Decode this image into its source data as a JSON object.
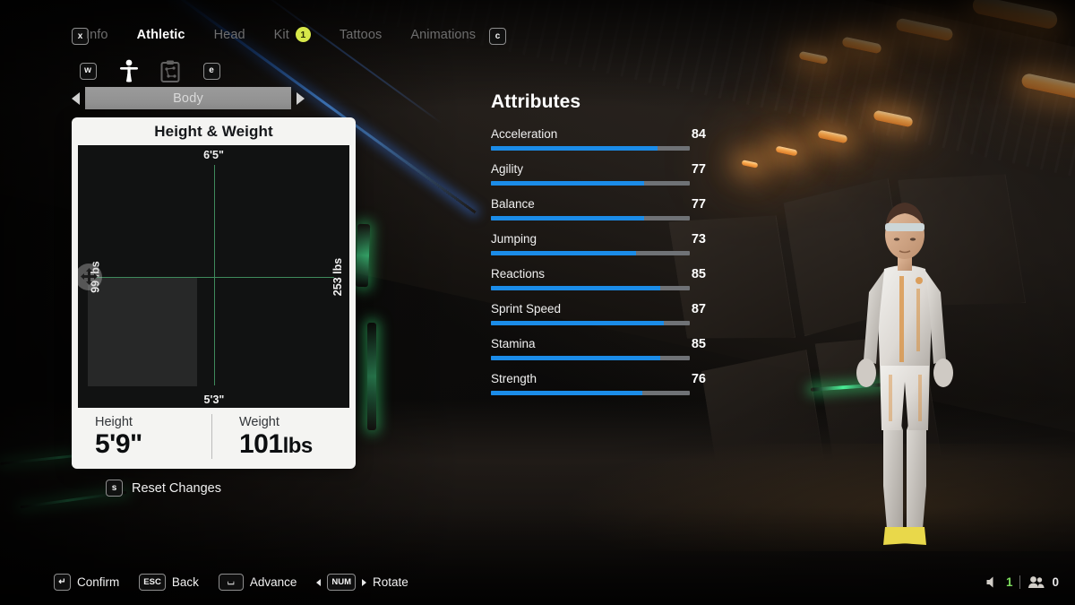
{
  "topbar": {
    "left_key": "x",
    "right_key": "c",
    "tabs": [
      {
        "label": "Info",
        "active": false,
        "badge": null
      },
      {
        "label": "Athletic",
        "active": true,
        "badge": null
      },
      {
        "label": "Head",
        "active": false,
        "badge": null
      },
      {
        "label": "Kit",
        "active": false,
        "badge": "1"
      },
      {
        "label": "Tattoos",
        "active": false,
        "badge": null
      },
      {
        "label": "Animations",
        "active": false,
        "badge": null
      }
    ]
  },
  "subtabs": {
    "left_key": "w",
    "right_key": "e",
    "icons": [
      {
        "name": "body-person-icon",
        "active": true
      },
      {
        "name": "attributes-clipboard-icon",
        "active": false
      }
    ]
  },
  "body_selector": {
    "label": "Body",
    "left_arrow": "◀",
    "right_arrow": "▶"
  },
  "height_weight": {
    "title": "Height & Weight",
    "graph": {
      "top_label": "6'5\"",
      "bottom_label": "5'3\"",
      "left_label": "99 lbs",
      "right_label": "253 lbs",
      "marker_icon": "move-handle-icon",
      "crosshair_color": "#3f8a5c"
    },
    "height_key": "Height",
    "height_value": "5'9\"",
    "weight_key": "Weight",
    "weight_value": "101",
    "weight_unit": "lbs"
  },
  "reset": {
    "key": "s",
    "label": "Reset Changes"
  },
  "attributes": {
    "title": "Attributes",
    "accent_color": "#1b8ce8",
    "track_color": "#6f7276",
    "max": 100,
    "items": [
      {
        "name": "Acceleration",
        "value": 84
      },
      {
        "name": "Agility",
        "value": 77
      },
      {
        "name": "Balance",
        "value": 77
      },
      {
        "name": "Jumping",
        "value": 73
      },
      {
        "name": "Reactions",
        "value": 85
      },
      {
        "name": "Sprint Speed",
        "value": 87
      },
      {
        "name": "Stamina",
        "value": 85
      },
      {
        "name": "Strength",
        "value": 76
      }
    ]
  },
  "commands": [
    {
      "key": "↵",
      "label": "Confirm",
      "wide": false,
      "arrows": false
    },
    {
      "key": "ESC",
      "label": "Back",
      "wide": true,
      "arrows": false
    },
    {
      "key": "⌴",
      "label": "Advance",
      "wide": true,
      "arrows": false
    },
    {
      "key": "NUM",
      "label": "Rotate",
      "wide": true,
      "arrows": true
    }
  ],
  "status": {
    "volume_icon": "volume-icon",
    "volume_value": "1",
    "players_icon": "players-icon",
    "players_value": "0"
  }
}
